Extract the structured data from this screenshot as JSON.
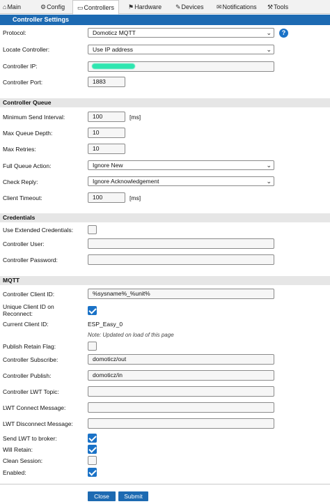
{
  "tabs": [
    {
      "icon": "⌂",
      "label": "Main"
    },
    {
      "icon": "⚙",
      "label": "Config"
    },
    {
      "icon": "▭",
      "label": "Controllers"
    },
    {
      "icon": "⚑",
      "label": "Hardware"
    },
    {
      "icon": "✎",
      "label": "Devices"
    },
    {
      "icon": "✉",
      "label": "Notifications"
    },
    {
      "icon": "⚒",
      "label": "Tools"
    }
  ],
  "header": {
    "title": "Controller Settings"
  },
  "controller": {
    "protocol_label": "Protocol:",
    "protocol_value": "Domoticz MQTT",
    "help_icon": "?",
    "locate_label": "Locate Controller:",
    "locate_value": "Use IP address",
    "ip_label": "Controller IP:",
    "port_label": "Controller Port:",
    "port_value": "1883"
  },
  "queue": {
    "title": "Controller Queue",
    "min_interval_label": "Minimum Send Interval:",
    "min_interval_value": "100",
    "min_interval_unit": "[ms]",
    "max_depth_label": "Max Queue Depth:",
    "max_depth_value": "10",
    "max_retries_label": "Max Retries:",
    "max_retries_value": "10",
    "full_action_label": "Full Queue Action:",
    "full_action_value": "Ignore New",
    "check_reply_label": "Check Reply:",
    "check_reply_value": "Ignore Acknowledgement",
    "timeout_label": "Client Timeout:",
    "timeout_value": "100",
    "timeout_unit": "[ms]"
  },
  "credentials": {
    "title": "Credentials",
    "extended_label": "Use Extended Credentials:",
    "extended_checked": false,
    "user_label": "Controller User:",
    "user_value": "",
    "password_label": "Controller Password:",
    "password_value": ""
  },
  "mqtt": {
    "title": "MQTT",
    "client_id_label": "Controller Client ID:",
    "client_id_value": "%sysname%_%unit%",
    "unique_id_label_1": "Unique Client ID on",
    "unique_id_label_2": "Reconnect:",
    "unique_id_checked": true,
    "current_id_label": "Current Client ID:",
    "current_id_value": "ESP_Easy_0",
    "current_id_note": "Note: Updated on load of this page",
    "retain_label": "Publish Retain Flag:",
    "retain_checked": false,
    "subscribe_label": "Controller Subscribe:",
    "subscribe_value": "domoticz/out",
    "publish_label": "Controller Publish:",
    "publish_value": "domoticz/in",
    "lwt_topic_label": "Controller LWT Topic:",
    "lwt_topic_value": "",
    "lwt_connect_label": "LWT Connect Message:",
    "lwt_connect_value": "",
    "lwt_disconnect_label": "LWT Disconnect Message:",
    "lwt_disconnect_value": "",
    "send_lwt_label": "Send LWT to broker:",
    "send_lwt_checked": true,
    "will_retain_label": "Will Retain:",
    "will_retain_checked": true,
    "clean_session_label": "Clean Session:",
    "clean_session_checked": false,
    "enabled_label": "Enabled:",
    "enabled_checked": true
  },
  "buttons": {
    "close": "Close",
    "submit": "Submit"
  },
  "colors": {
    "accent": "#1d6ab2",
    "section_bg": "#e6e6e6",
    "checkbox_on": "#1a72c7"
  }
}
